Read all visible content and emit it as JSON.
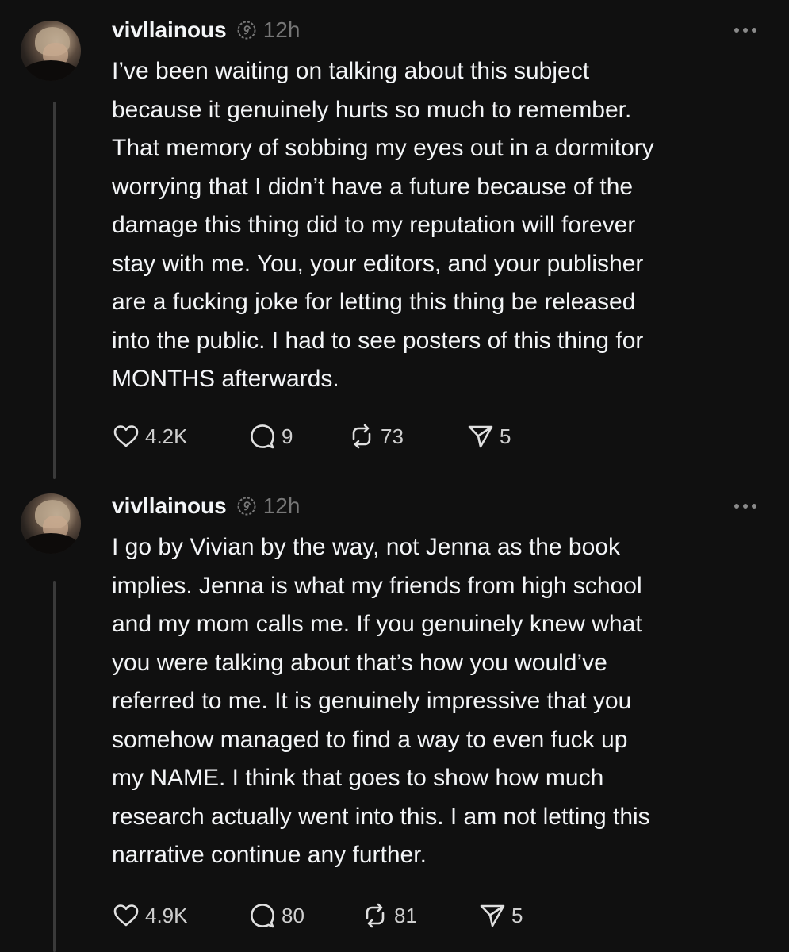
{
  "posts": [
    {
      "username": "vivllainous",
      "time": "12h",
      "text": "I’ve been waiting on talking about this subject\nbecause it genuinely hurts so much to remember.\nThat memory of sobbing my eyes out in a dormitory\nworrying that I didn’t have a future because of the\ndamage this thing did to my reputation will forever\nstay with me. You, your editors, and your publisher\nare a fucking joke for letting this thing be released\ninto the public. I had to see posters of this thing for\nMONTHS afterwards.",
      "likes": "4.2K",
      "replies": "9",
      "reposts": "73",
      "shares": "5"
    },
    {
      "username": "vivllainous",
      "time": "12h",
      "text": "I go by Vivian by the way, not Jenna as the book\nimplies. Jenna is what my friends from high school\nand my mom calls me. If you genuinely knew what\nyou were talking about that’s how you would’ve\nreferred to me. It is genuinely impressive that you\nsomehow managed to find a way to even fuck up\nmy NAME. I think that goes to show how much\nresearch actually went into this. I am not letting this\nnarrative continue any further.",
      "likes": "4.9K",
      "replies": "80",
      "reposts": "81",
      "shares": "5"
    }
  ],
  "colors": {
    "background": "#101010",
    "text": "#f3f5f7",
    "muted": "#777777",
    "thread_line": "#3a3a3a"
  },
  "icons": [
    "threads-verified-icon",
    "more-icon",
    "heart-icon",
    "comment-icon",
    "repost-icon",
    "share-icon"
  ]
}
